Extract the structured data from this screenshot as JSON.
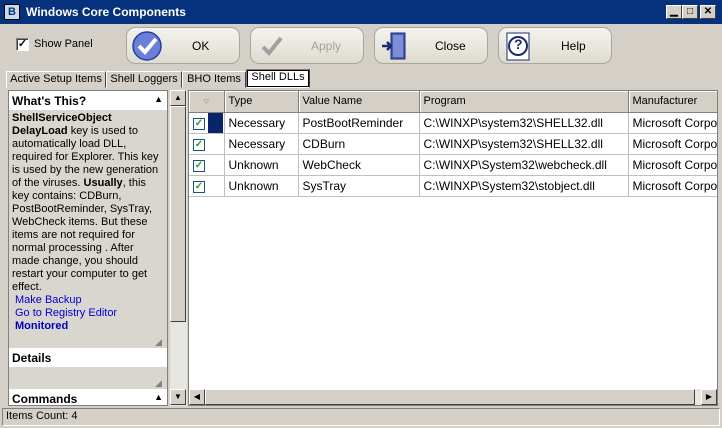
{
  "window": {
    "title": "Windows Core Components",
    "app_icon_glyph": "B"
  },
  "toolbar": {
    "show_panel_label": "Show Panel",
    "show_panel_checked": true,
    "ok_label": "OK",
    "apply_label": "Apply",
    "close_label": "Close",
    "help_label": "Help",
    "help_icon_glyph": "?",
    "check_glyph": "✓"
  },
  "tabs": [
    {
      "label": "Active Setup Items"
    },
    {
      "label": "Shell Loggers"
    },
    {
      "label": "BHO Items"
    },
    {
      "label": "Shell DLLs",
      "active": true
    }
  ],
  "panel": {
    "whats_this": {
      "header": "What's This?",
      "key_title": "ShellServiceObject DelayLoad",
      "text_a": " key is used to automatically load DLL, required for Explorer. This key is used by the new generation of the viruses. ",
      "text_bold": "Usually",
      "text_b": ", this key contains: CDBurn, PostBootReminder, SysTray, WebCheck items. But these items are not required for normal processing . After made change, you should restart your computer to get effect.",
      "make_backup": "Make Backup",
      "go_registry": "Go to Registry Editor",
      "monitored": "Monitored"
    },
    "details_header": "Details",
    "commands_header": "Commands"
  },
  "grid": {
    "columns": [
      "Type",
      "Value Name",
      "Program",
      "Manufacturer"
    ],
    "rows": [
      {
        "type": "Necessary",
        "value_name": "PostBootReminder",
        "program": "C:\\WINXP\\system32\\SHELL32.dll",
        "manufacturer": "Microsoft Corpo"
      },
      {
        "type": "Necessary",
        "value_name": "CDBurn",
        "program": "C:\\WINXP\\system32\\SHELL32.dll",
        "manufacturer": "Microsoft Corpo"
      },
      {
        "type": "Unknown",
        "value_name": "WebCheck",
        "program": "C:\\WINXP\\System32\\webcheck.dll",
        "manufacturer": "Microsoft Corpo"
      },
      {
        "type": "Unknown",
        "value_name": "SysTray",
        "program": "C:\\WINXP\\System32\\stobject.dll",
        "manufacturer": "Microsoft Corpo"
      }
    ]
  },
  "status": {
    "items_count": "Items Count: 4"
  },
  "colors": {
    "titlebar": "#06317c",
    "selection": "#0a246a",
    "link": "#0000d8",
    "check_green": "#21a121"
  },
  "icons": [
    "app-icon",
    "ok-check-icon",
    "apply-check-icon",
    "close-door-icon",
    "help-icon",
    "minimize-icon",
    "maximize-icon",
    "close-window-icon"
  ]
}
